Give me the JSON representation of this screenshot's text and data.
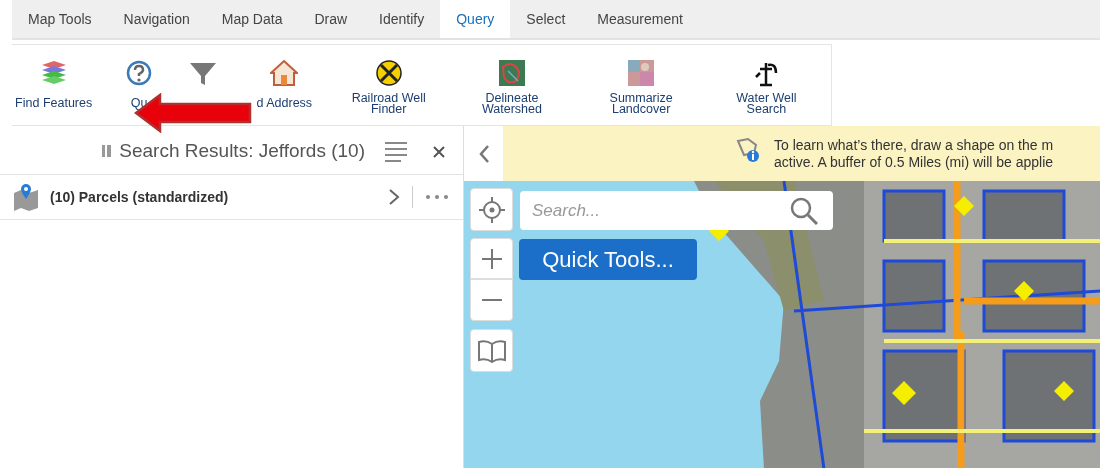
{
  "tabs": [
    {
      "label": "Map Tools",
      "selected": false
    },
    {
      "label": "Navigation",
      "selected": false
    },
    {
      "label": "Map Data",
      "selected": false
    },
    {
      "label": "Draw",
      "selected": false
    },
    {
      "label": "Identify",
      "selected": false
    },
    {
      "label": "Query",
      "selected": true
    },
    {
      "label": "Select",
      "selected": false
    },
    {
      "label": "Measurement",
      "selected": false
    }
  ],
  "tools": [
    {
      "kind": "labeled",
      "label": "Find Features"
    },
    {
      "kind": "labeled",
      "label": "Qu"
    },
    {
      "kind": "icon"
    },
    {
      "kind": "labeled",
      "label": "d Address"
    },
    {
      "kind": "labeled",
      "label": "Railroad Well Finder"
    },
    {
      "kind": "labeled",
      "label": "Delineate Watershed"
    },
    {
      "kind": "labeled",
      "label": "Summarize Landcover"
    },
    {
      "kind": "labeled",
      "label": "Water Well Search"
    }
  ],
  "results": {
    "title": "Search Results: Jeffords (10)",
    "items": [
      {
        "label": "(10) Parcels (standardized)"
      }
    ]
  },
  "map": {
    "banner": [
      "To learn what’s there, draw a shape on the m",
      "active. A buffer of 0.5 Miles (mi) will be applie"
    ],
    "search": {
      "placeholder": "Search..."
    },
    "quick_tools": "Quick Tools..."
  }
}
